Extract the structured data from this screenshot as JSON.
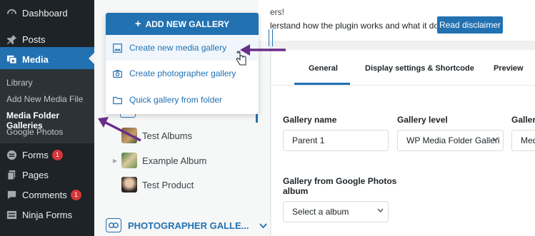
{
  "sidebar": {
    "items": [
      {
        "label": "Dashboard",
        "icon": "dashboard-icon"
      },
      {
        "label": "Posts",
        "icon": "pin-icon"
      },
      {
        "label": "Media",
        "icon": "media-icon"
      },
      {
        "label": "Forms",
        "icon": "forms-icon",
        "badge": "1"
      },
      {
        "label": "Pages",
        "icon": "pages-icon"
      },
      {
        "label": "Comments",
        "icon": "comment-icon",
        "badge": "1"
      },
      {
        "label": "Ninja Forms",
        "icon": "ninja-forms-icon"
      }
    ],
    "submenu": [
      "Library",
      "Add New Media File",
      "Media Folder Galleries",
      "Google Photos"
    ]
  },
  "dropdown": {
    "add_label": "ADD NEW GALLERY",
    "items": [
      "Create new media gallery",
      "Create photographer gallery",
      "Quick gallery from folder"
    ]
  },
  "tree": {
    "items": [
      "Test Albums",
      "Example Album",
      "Test Product"
    ],
    "photographer_label": "PHOTOGRAPHER GALLE..."
  },
  "notice": {
    "line1": "ers!",
    "line2": "lerstand how the plugin works and what it does",
    "button": "Read disclaimer"
  },
  "tabs": [
    "General",
    "Display settings & Shortcode",
    "Preview"
  ],
  "form": {
    "gallery_name_label": "Gallery name",
    "gallery_name_value": "Parent 1",
    "gallery_level_label": "Gallery level",
    "gallery_level_value": "WP Media Folder Galleri",
    "gallery_theme_label": "Gallery",
    "gallery_theme_value": "Medi",
    "google_label": "Gallery from Google Photos album",
    "google_value": "Select a album"
  },
  "colors": {
    "accent": "#2271b1",
    "sidebar_bg": "#1d2327",
    "arrow": "#6b2d8a"
  }
}
